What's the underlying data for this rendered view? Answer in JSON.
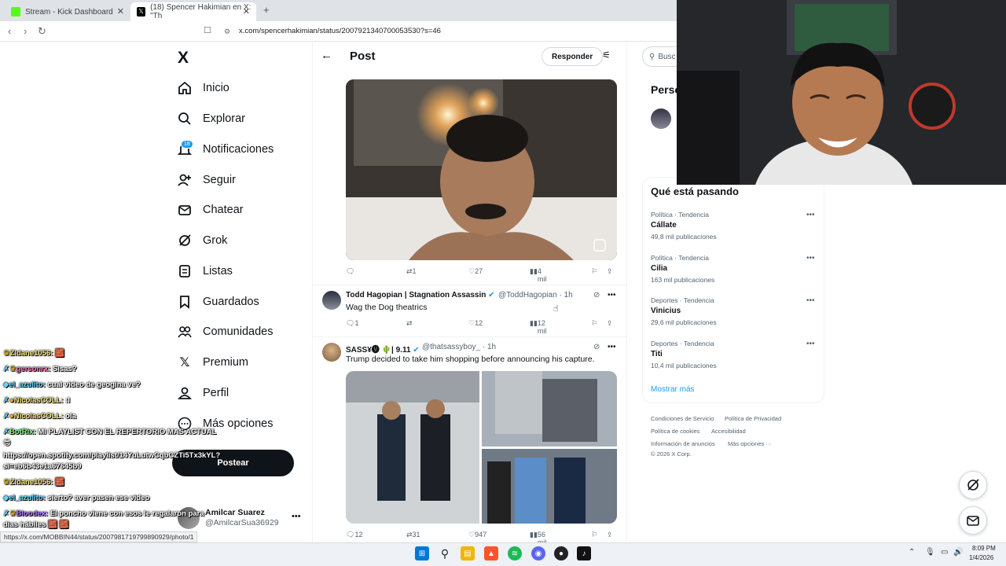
{
  "browser": {
    "tabs": [
      {
        "title": "Stream - Kick Dashboard",
        "active": false
      },
      {
        "title": "(18) Spencer Hakimian en X: \"Th",
        "active": true
      }
    ],
    "new_tab_symbol": "+",
    "url": "x.com/spencerhakimian/status/2007921340700053530?s=46",
    "status_url": "https://x.com/MOBBIN44/status/2007981719799890929/photo/1"
  },
  "nav": {
    "logo": "X",
    "notification_count": "18",
    "items": [
      {
        "label": "Inicio",
        "icon": "home-icon"
      },
      {
        "label": "Explorar",
        "icon": "search-icon"
      },
      {
        "label": "Notificaciones",
        "icon": "bell-icon"
      },
      {
        "label": "Seguir",
        "icon": "follow-icon"
      },
      {
        "label": "Chatear",
        "icon": "mail-icon"
      },
      {
        "label": "Grok",
        "icon": "grok-icon"
      },
      {
        "label": "Listas",
        "icon": "list-icon"
      },
      {
        "label": "Guardados",
        "icon": "bookmark-icon"
      },
      {
        "label": "Comunidades",
        "icon": "communities-icon"
      },
      {
        "label": "Premium",
        "icon": "x-premium-icon"
      },
      {
        "label": "Perfil",
        "icon": "profile-icon"
      },
      {
        "label": "Más opciones",
        "icon": "more-options-icon"
      }
    ],
    "post_button": "Postear",
    "user": {
      "name": "Amilcar Suarez",
      "handle": "@AmilcarSua36929"
    }
  },
  "chat": [
    {
      "user": "Zldane1056:",
      "text": "🧱",
      "color": "#f7e67a"
    },
    {
      "user": "gersonrx:",
      "text": "Sisas?",
      "color": "#ff7eb6"
    },
    {
      "user": "el_azulito:",
      "text": "cual video de geogina ve?",
      "color": "#5fd7ff"
    },
    {
      "user": "NicolasCOLL:",
      "text": ":I",
      "color": "#f7e67a"
    },
    {
      "user": "NicolasCOLL:",
      "text": "ola",
      "color": "#f7e67a"
    },
    {
      "user": "BotRix:",
      "text": "MI PLAYLIST CON EL REPERTORIO MAS ACTUAL",
      "color": "#86f58b"
    },
    {
      "user": "",
      "text": "https://open.spotify.com/playlist/14YuLutwCqbCZTi5Tx3kYL?",
      "color": "#fff"
    },
    {
      "user": "",
      "text": "si=eb6b43e1a67645b9",
      "color": "#fff"
    },
    {
      "user": "Zldane1056:",
      "text": "🧱",
      "color": "#f7e67a"
    },
    {
      "user": "el_azulito:",
      "text": "sierto? aver pasen ese video",
      "color": "#5fd7ff"
    },
    {
      "user": "Bloodex:",
      "text": "El poncho viene con esos le regalaron para",
      "color": "#b07cff"
    },
    {
      "user": "",
      "text": "dias hábiles 🧱 🧱",
      "color": "#fff"
    }
  ],
  "post_header": {
    "title": "Post",
    "reply_button": "Responder"
  },
  "tweets": [
    {
      "kind": "media-only",
      "stats": {
        "replies": "",
        "retweets": "1",
        "likes": "27",
        "views": "4 mil"
      }
    },
    {
      "name": "Todd Hagopian | Stagnation Assassin",
      "verified": true,
      "handle": "@ToddHagopian",
      "time": "· 1h",
      "text": "Wag the Dog theatrics",
      "stats": {
        "replies": "1",
        "retweets": "",
        "likes": "12",
        "views": "12 mil"
      }
    },
    {
      "name": "SASS¥🅥 🌵| 9.11",
      "verified": true,
      "handle": "@thatsassyboy_",
      "time": "· 1h",
      "text": "Trump decided to take him shopping before announcing his capture.",
      "stats": {
        "replies": "12",
        "retweets": "31",
        "likes": "947",
        "views": "56 mil"
      }
    }
  ],
  "right": {
    "search_placeholder": "Busc",
    "persons_title": "Perso",
    "trends_title": "Qué está pasando",
    "trends": [
      {
        "meta": "Política · Tendencia",
        "name": "Cállate",
        "count": "49,8 mil publicaciones"
      },
      {
        "meta": "Política · Tendencia",
        "name": "Cilia",
        "count": "163 mil publicaciones"
      },
      {
        "meta": "Deportes · Tendencia",
        "name": "Vinicius",
        "count": "29,6 mil publicaciones"
      },
      {
        "meta": "Deportes · Tendencia",
        "name": "Titi",
        "count": "10,4 mil publicaciones"
      }
    ],
    "show_more": "Mostrar más",
    "footer": {
      "terms": "Condiciones de Servicio",
      "privacy": "Política de Privacidad",
      "cookies": "Política de cookies",
      "accessibility": "Accesibilidad",
      "ads": "Información de anuncios",
      "more": "Más opciones ···",
      "copyright": "© 2026 X Corp."
    }
  },
  "taskbar": {
    "time": "8:09 PM",
    "date": "1/4/2026"
  },
  "colors": {
    "accent": "#1d9bf0",
    "text": "#0f1419",
    "muted": "#536471"
  }
}
